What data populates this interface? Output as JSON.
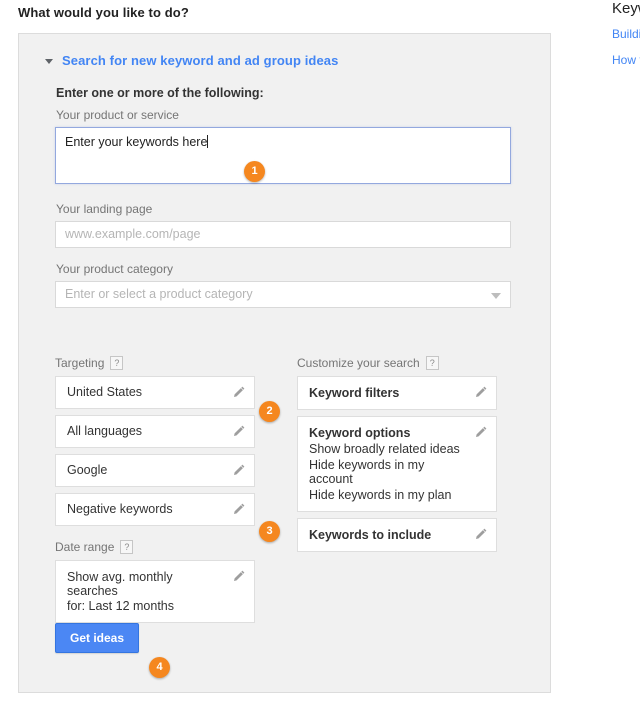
{
  "page": {
    "title": "What would you like to do?"
  },
  "right_rail": {
    "title": "Keyw",
    "links": [
      {
        "label": "Buildin"
      },
      {
        "label": "How to"
      }
    ]
  },
  "panel": {
    "section_header": "Search for new keyword and ad group ideas",
    "collapse_icon": "triangle-down-icon",
    "subheading": "Enter one or more of the following:",
    "fields": {
      "product_or_service": {
        "label": "Your product or service",
        "value": "Enter your keywords here"
      },
      "landing_page": {
        "label": "Your landing page",
        "placeholder": "www.example.com/page",
        "value": ""
      },
      "product_category": {
        "label": "Your product category",
        "placeholder": "Enter or select a product category",
        "value": "",
        "dropdown_icon": "chevron-down-icon"
      }
    },
    "targeting": {
      "label": "Targeting",
      "help_icon": "?",
      "rows": [
        {
          "label": "United States",
          "edit_icon": "pencil-icon"
        },
        {
          "label": "All languages",
          "edit_icon": "pencil-icon"
        },
        {
          "label": "Google",
          "edit_icon": "pencil-icon"
        },
        {
          "label": "Negative keywords",
          "edit_icon": "pencil-icon"
        }
      ]
    },
    "date_range": {
      "label": "Date range",
      "help_icon": "?",
      "value_line1": "Show avg. monthly searches",
      "value_line2": "for: Last 12 months",
      "edit_icon": "pencil-icon"
    },
    "customize": {
      "label": "Customize your search",
      "help_icon": "?",
      "keyword_filters": {
        "title": "Keyword filters",
        "edit_icon": "pencil-icon"
      },
      "keyword_options": {
        "title": "Keyword options",
        "items": [
          "Show broadly related ideas",
          "Hide keywords in my account",
          "Hide keywords in my plan"
        ],
        "edit_icon": "pencil-icon"
      },
      "keywords_to_include": {
        "title": "Keywords to include",
        "edit_icon": "pencil-icon"
      }
    },
    "submit_button": "Get ideas"
  },
  "badges": [
    {
      "number": "1"
    },
    {
      "number": "2"
    },
    {
      "number": "3"
    },
    {
      "number": "4"
    }
  ],
  "colors": {
    "accent_blue": "#4285f4",
    "button_blue": "#4b87f4",
    "badge_orange": "#f5871f",
    "panel_background": "#f1f1f1",
    "focus_border": "#93a8de"
  }
}
